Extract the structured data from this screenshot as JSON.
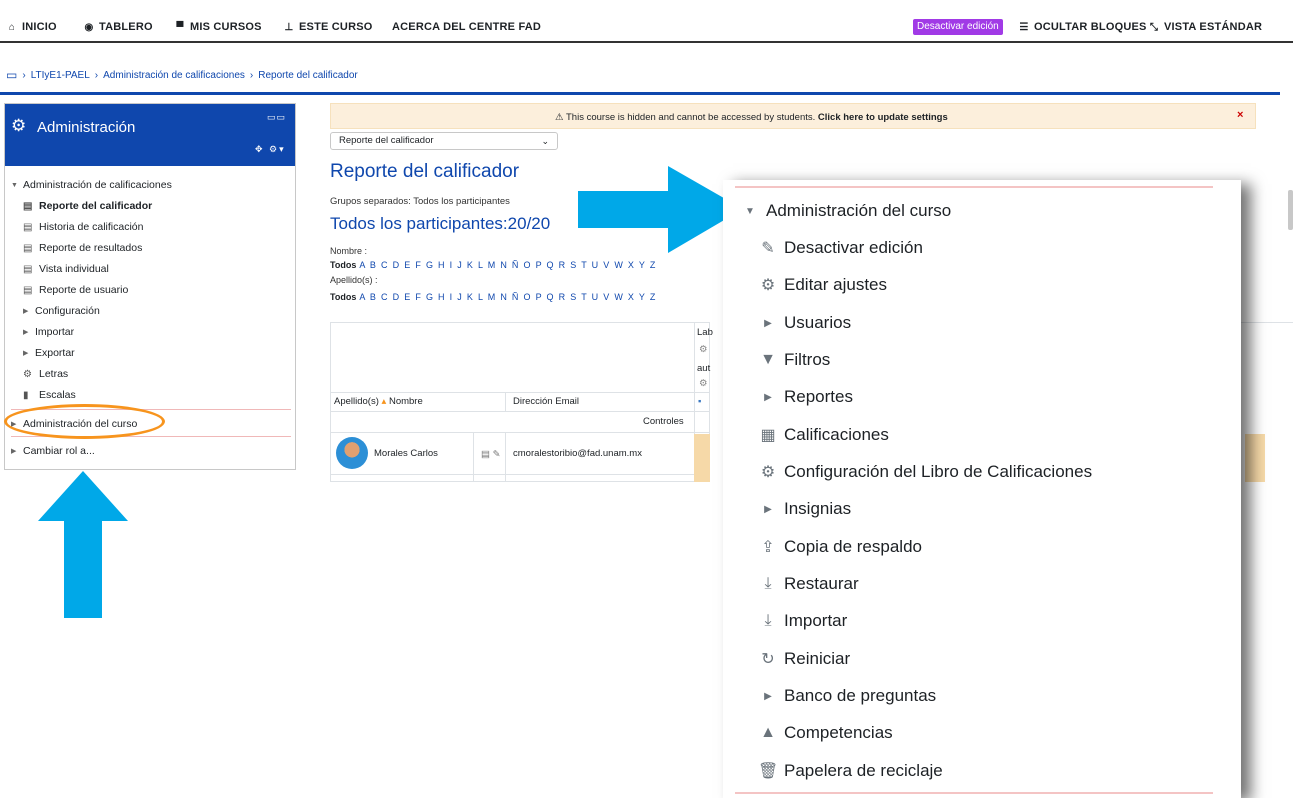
{
  "nav": {
    "inicio": "INICIO",
    "tablero": "TABLERO",
    "mis_cursos": "MIS CURSOS",
    "este_curso": "ESTE CURSO",
    "acerca": "ACERCA DEL CENTRE FAD",
    "desactivar": "Desactivar edición",
    "ocultar": "OCULTAR BLOQUES",
    "vista": "VISTA ESTÁNDAR"
  },
  "breadcrumb": [
    "LTIyE1-PAEL",
    "Administración de calificaciones",
    "Reporte del calificador"
  ],
  "admin": {
    "title": "Administración",
    "items": [
      "Administración de calificaciones",
      "Reporte del calificador",
      "Historia de calificación",
      "Reporte de resultados",
      "Vista individual",
      "Reporte de usuario",
      "Configuración",
      "Importar",
      "Exportar",
      "Letras",
      "Escalas",
      "Administración del curso",
      "Cambiar rol a..."
    ]
  },
  "warning": {
    "text": "This course is hidden and cannot be accessed by students.",
    "link": "Click here to update settings",
    "close": "×"
  },
  "report": {
    "select": "Reporte del calificador",
    "title": "Reporte del calificador",
    "groups": "Grupos separados: Todos los participantes",
    "participants": "Todos los participantes:20/20",
    "nombre_label": "Nombre :",
    "apellido_label": "Apellido(s) :",
    "todos": "Todos",
    "letters": "A B C D E F G H I J K L M N Ñ O P Q R S T U V W X Y Z"
  },
  "table": {
    "col_apellido": "Apellido(s)",
    "col_nombre": "Nombre",
    "col_email": "Dirección Email",
    "controles": "Controles",
    "head_lab": "Lab",
    "head_aut": "aut",
    "row_name": "Morales Carlos",
    "row_email": "cmoralestoribio@fad.unam.mx"
  },
  "zoom": {
    "header": "Administración del curso",
    "items": [
      "Desactivar edición",
      "Editar ajustes",
      "Usuarios",
      "Filtros",
      "Reportes",
      "Calificaciones",
      "Configuración del Libro de Calificaciones",
      "Insignias",
      "Copia de respaldo",
      "Restaurar",
      "Importar",
      "Reiniciar",
      "Banco de preguntas",
      "Competencias",
      "Papelera de reciclaje"
    ]
  },
  "colors": {
    "brand_blue": "#0f47ad",
    "purple_button": "#a13ae6",
    "arrow_blue": "#00a8e8",
    "highlight_orange": "#f7941d"
  }
}
